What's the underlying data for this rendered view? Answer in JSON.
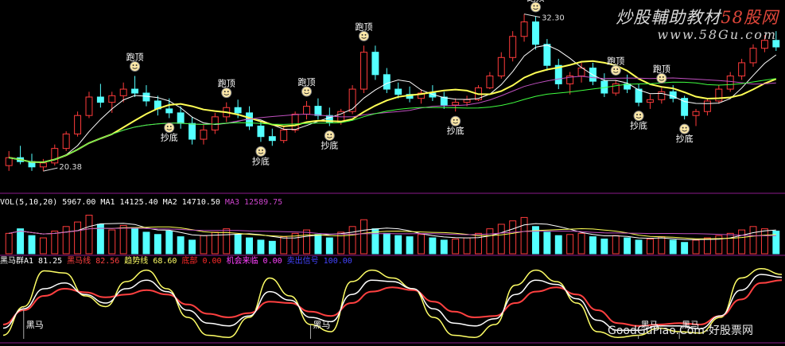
{
  "watermark": {
    "brand_main": "炒股輔助教材",
    "brand_accent": "58股网",
    "site_url": "www.58Gu.com",
    "footer": "GoodGuPiao.Com-好股票网"
  },
  "chart_data": [
    {
      "type": "candlestick",
      "title": "",
      "price_high_label": "32.30",
      "price_low_label": "20.38",
      "ylim": [
        19,
        33
      ],
      "candles": [
        [
          20.8,
          21.9,
          20.4,
          21.4
        ],
        [
          21.4,
          22.3,
          20.9,
          21.1
        ],
        [
          21.1,
          21.7,
          20.4,
          20.7
        ],
        [
          20.7,
          21.3,
          20.38,
          21.0
        ],
        [
          21.0,
          22.4,
          20.8,
          22.1
        ],
        [
          22.1,
          23.4,
          21.9,
          23.2
        ],
        [
          23.2,
          24.9,
          23.0,
          24.6
        ],
        [
          24.6,
          26.4,
          24.4,
          26.0
        ],
        [
          26.0,
          27.0,
          25.2,
          25.6
        ],
        [
          25.6,
          26.4,
          24.8,
          26.1
        ],
        [
          26.1,
          27.1,
          25.6,
          26.6
        ],
        [
          26.6,
          27.6,
          26.0,
          26.3
        ],
        [
          26.3,
          26.9,
          25.3,
          25.7
        ],
        [
          25.7,
          26.1,
          24.6,
          25.1
        ],
        [
          25.1,
          25.9,
          24.4,
          24.8
        ],
        [
          24.8,
          25.3,
          23.6,
          24.0
        ],
        [
          24.0,
          24.5,
          22.4,
          22.8
        ],
        [
          22.8,
          23.9,
          22.4,
          23.5
        ],
        [
          23.5,
          24.8,
          23.2,
          24.5
        ],
        [
          24.5,
          25.6,
          24.1,
          25.2
        ],
        [
          25.2,
          25.8,
          24.4,
          24.8
        ],
        [
          24.8,
          25.3,
          23.5,
          23.8
        ],
        [
          23.8,
          24.2,
          22.6,
          23.0
        ],
        [
          23.0,
          23.6,
          22.3,
          22.7
        ],
        [
          22.7,
          23.8,
          22.5,
          23.5
        ],
        [
          23.5,
          24.9,
          23.3,
          24.7
        ],
        [
          24.7,
          25.7,
          24.3,
          25.3
        ],
        [
          25.3,
          25.9,
          24.3,
          24.6
        ],
        [
          24.6,
          25.2,
          23.8,
          24.1
        ],
        [
          24.1,
          25.1,
          23.9,
          24.9
        ],
        [
          24.9,
          26.9,
          24.7,
          26.6
        ],
        [
          26.6,
          29.9,
          26.3,
          29.4
        ],
        [
          29.4,
          29.9,
          27.3,
          27.7
        ],
        [
          27.7,
          28.2,
          26.3,
          26.6
        ],
        [
          26.6,
          27.1,
          25.9,
          26.2
        ],
        [
          26.2,
          26.8,
          25.6,
          25.9
        ],
        [
          25.9,
          26.6,
          25.5,
          26.3
        ],
        [
          26.3,
          26.9,
          25.7,
          26.0
        ],
        [
          26.0,
          26.4,
          25.1,
          25.4
        ],
        [
          25.4,
          25.9,
          24.9,
          25.6
        ],
        [
          25.6,
          26.1,
          25.3,
          25.8
        ],
        [
          25.8,
          26.9,
          25.7,
          26.7
        ],
        [
          26.7,
          27.9,
          26.6,
          27.6
        ],
        [
          27.6,
          29.4,
          27.4,
          29.0
        ],
        [
          29.0,
          31.0,
          28.7,
          30.6
        ],
        [
          30.6,
          32.3,
          30.2,
          31.7
        ],
        [
          31.7,
          32.1,
          29.6,
          30.0
        ],
        [
          30.0,
          30.4,
          28.0,
          28.4
        ],
        [
          28.4,
          28.9,
          26.6,
          27.0
        ],
        [
          27.0,
          27.9,
          26.2,
          27.6
        ],
        [
          27.6,
          28.6,
          27.1,
          28.2
        ],
        [
          28.2,
          28.6,
          26.9,
          27.2
        ],
        [
          27.2,
          27.8,
          26.0,
          26.3
        ],
        [
          26.3,
          27.3,
          26.1,
          27.0
        ],
        [
          27.0,
          27.7,
          26.3,
          26.6
        ],
        [
          26.6,
          27.0,
          25.3,
          25.6
        ],
        [
          25.6,
          26.2,
          25.1,
          25.8
        ],
        [
          25.8,
          26.7,
          25.5,
          26.4
        ],
        [
          26.4,
          26.9,
          25.6,
          25.9
        ],
        [
          25.9,
          26.1,
          24.3,
          24.6
        ],
        [
          24.6,
          25.1,
          23.8,
          24.9
        ],
        [
          24.9,
          25.9,
          24.6,
          25.7
        ],
        [
          25.7,
          26.9,
          25.5,
          26.6
        ],
        [
          26.6,
          27.9,
          26.4,
          27.6
        ],
        [
          27.6,
          28.9,
          27.3,
          28.6
        ],
        [
          28.6,
          30.0,
          28.3,
          29.7
        ],
        [
          29.7,
          30.7,
          29.4,
          30.3
        ],
        [
          30.3,
          31.0,
          29.5,
          29.8
        ]
      ],
      "markers": [
        {
          "label": "跑顶",
          "index": 11,
          "price": 27.6,
          "kind": "top"
        },
        {
          "label": "抄底",
          "index": 14,
          "price": 24.4,
          "kind": "bottom"
        },
        {
          "label": "跑顶",
          "index": 19,
          "price": 25.6,
          "kind": "top"
        },
        {
          "label": "抄底",
          "index": 22,
          "price": 22.6,
          "kind": "bottom"
        },
        {
          "label": "跑顶",
          "index": 26,
          "price": 25.7,
          "kind": "top"
        },
        {
          "label": "抄底",
          "index": 28,
          "price": 23.8,
          "kind": "bottom"
        },
        {
          "label": "跑顶",
          "index": 31,
          "price": 29.9,
          "kind": "top"
        },
        {
          "label": "抄底",
          "index": 39,
          "price": 24.9,
          "kind": "bottom"
        },
        {
          "label": "跑顶",
          "index": 46,
          "price": 32.1,
          "kind": "top"
        },
        {
          "label": "跑顶",
          "index": 53,
          "price": 27.3,
          "kind": "top"
        },
        {
          "label": "抄底",
          "index": 55,
          "price": 25.3,
          "kind": "bottom"
        },
        {
          "label": "跑顶",
          "index": 57,
          "price": 26.7,
          "kind": "top"
        },
        {
          "label": "抄底",
          "index": 59,
          "price": 24.3,
          "kind": "bottom"
        }
      ]
    },
    {
      "type": "bar",
      "title": "VOL(5,10,20)",
      "readouts": [
        {
          "label": "VOL(5,10,20)",
          "value": "5967.00",
          "color": "#ffffff"
        },
        {
          "label": "MA1",
          "value": "14125.40",
          "color": "#ffffff"
        },
        {
          "label": "MA2",
          "value": "14710.50",
          "color": "#ffffff"
        },
        {
          "label": "MA3",
          "value": "12589.75",
          "color": "#cc44cc"
        }
      ],
      "values": [
        18,
        22,
        16,
        14,
        20,
        24,
        28,
        34,
        26,
        21,
        25,
        23,
        19,
        17,
        20,
        15,
        12,
        16,
        19,
        22,
        17,
        14,
        12,
        11,
        15,
        18,
        21,
        17,
        14,
        19,
        24,
        30,
        22,
        18,
        16,
        15,
        17,
        14,
        12,
        13,
        14,
        18,
        22,
        26,
        29,
        32,
        24,
        19,
        16,
        17,
        18,
        15,
        13,
        16,
        14,
        12,
        13,
        15,
        12,
        10,
        12,
        14,
        16,
        18,
        21,
        24,
        22,
        20
      ],
      "ylim": [
        0,
        40
      ]
    },
    {
      "type": "line",
      "title": "黑马群A1",
      "readouts": [
        {
          "label": "黑马群A1",
          "value": "81.25",
          "color": "#ffffff"
        },
        {
          "label": "黑马线",
          "value": "82.56",
          "color": "#ff4040"
        },
        {
          "label": "趋势线",
          "value": "68.60",
          "color": "#ffff66"
        },
        {
          "label": "底部",
          "value": "0.00",
          "color": "#ff2a2a"
        },
        {
          "label": "机会来临",
          "value": "0.00",
          "color": "#ff40ff"
        },
        {
          "label": "卖出信号",
          "value": "100.00",
          "color": "#4444ff"
        }
      ],
      "ylim": [
        0,
        100
      ],
      "series": [
        {
          "name": "趋势线",
          "color": "#ffff66",
          "values": [
            5,
            45,
            95,
            92,
            60,
            45,
            80,
            96,
            70,
            30,
            5,
            2,
            30,
            85,
            60,
            20,
            10,
            80,
            96,
            85,
            70,
            30,
            5,
            2,
            20,
            75,
            96,
            80,
            50,
            10,
            2,
            5,
            15,
            10,
            8,
            30,
            85,
            98,
            90
          ]
        },
        {
          "name": "黑马线",
          "color": "#ff4040",
          "values": [
            20,
            40,
            60,
            70,
            65,
            58,
            62,
            68,
            62,
            48,
            35,
            30,
            36,
            52,
            50,
            38,
            32,
            50,
            66,
            72,
            68,
            52,
            38,
            30,
            32,
            50,
            66,
            72,
            62,
            40,
            22,
            18,
            20,
            22,
            20,
            32,
            55,
            78,
            82
          ]
        },
        {
          "name": "黑马群A1",
          "color": "#ffffff",
          "values": [
            15,
            42,
            70,
            78,
            62,
            50,
            70,
            82,
            66,
            40,
            22,
            18,
            32,
            66,
            54,
            30,
            24,
            62,
            82,
            80,
            70,
            42,
            22,
            18,
            28,
            62,
            82,
            76,
            56,
            26,
            12,
            12,
            18,
            18,
            14,
            32,
            68,
            90,
            86
          ]
        }
      ],
      "signals": [
        {
          "label": "黑马",
          "index": 1
        },
        {
          "label": "黑马",
          "index": 15
        },
        {
          "label": "黑马",
          "index": 31
        },
        {
          "label": "黑马",
          "index": 33
        }
      ]
    }
  ]
}
